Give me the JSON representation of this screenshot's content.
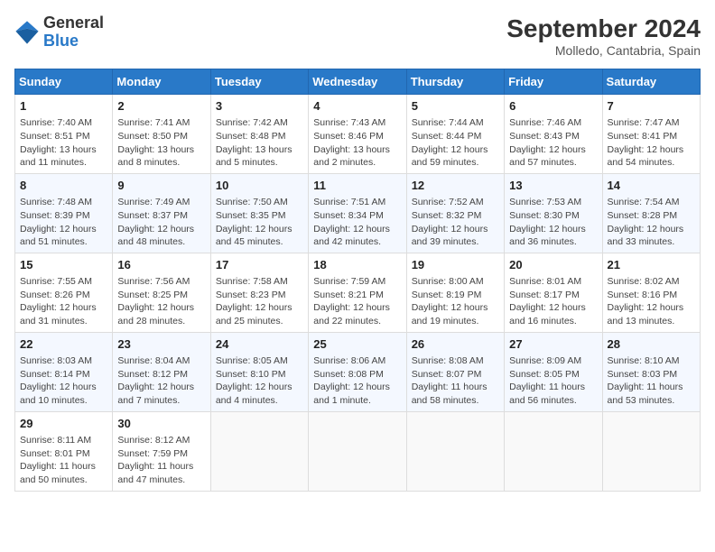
{
  "header": {
    "logo_general": "General",
    "logo_blue": "Blue",
    "month_year": "September 2024",
    "location": "Molledo, Cantabria, Spain"
  },
  "calendar": {
    "days_of_week": [
      "Sunday",
      "Monday",
      "Tuesday",
      "Wednesday",
      "Thursday",
      "Friday",
      "Saturday"
    ],
    "weeks": [
      [
        {
          "day": "1",
          "detail": "Sunrise: 7:40 AM\nSunset: 8:51 PM\nDaylight: 13 hours\nand 11 minutes."
        },
        {
          "day": "2",
          "detail": "Sunrise: 7:41 AM\nSunset: 8:50 PM\nDaylight: 13 hours\nand 8 minutes."
        },
        {
          "day": "3",
          "detail": "Sunrise: 7:42 AM\nSunset: 8:48 PM\nDaylight: 13 hours\nand 5 minutes."
        },
        {
          "day": "4",
          "detail": "Sunrise: 7:43 AM\nSunset: 8:46 PM\nDaylight: 13 hours\nand 2 minutes."
        },
        {
          "day": "5",
          "detail": "Sunrise: 7:44 AM\nSunset: 8:44 PM\nDaylight: 12 hours\nand 59 minutes."
        },
        {
          "day": "6",
          "detail": "Sunrise: 7:46 AM\nSunset: 8:43 PM\nDaylight: 12 hours\nand 57 minutes."
        },
        {
          "day": "7",
          "detail": "Sunrise: 7:47 AM\nSunset: 8:41 PM\nDaylight: 12 hours\nand 54 minutes."
        }
      ],
      [
        {
          "day": "8",
          "detail": "Sunrise: 7:48 AM\nSunset: 8:39 PM\nDaylight: 12 hours\nand 51 minutes."
        },
        {
          "day": "9",
          "detail": "Sunrise: 7:49 AM\nSunset: 8:37 PM\nDaylight: 12 hours\nand 48 minutes."
        },
        {
          "day": "10",
          "detail": "Sunrise: 7:50 AM\nSunset: 8:35 PM\nDaylight: 12 hours\nand 45 minutes."
        },
        {
          "day": "11",
          "detail": "Sunrise: 7:51 AM\nSunset: 8:34 PM\nDaylight: 12 hours\nand 42 minutes."
        },
        {
          "day": "12",
          "detail": "Sunrise: 7:52 AM\nSunset: 8:32 PM\nDaylight: 12 hours\nand 39 minutes."
        },
        {
          "day": "13",
          "detail": "Sunrise: 7:53 AM\nSunset: 8:30 PM\nDaylight: 12 hours\nand 36 minutes."
        },
        {
          "day": "14",
          "detail": "Sunrise: 7:54 AM\nSunset: 8:28 PM\nDaylight: 12 hours\nand 33 minutes."
        }
      ],
      [
        {
          "day": "15",
          "detail": "Sunrise: 7:55 AM\nSunset: 8:26 PM\nDaylight: 12 hours\nand 31 minutes."
        },
        {
          "day": "16",
          "detail": "Sunrise: 7:56 AM\nSunset: 8:25 PM\nDaylight: 12 hours\nand 28 minutes."
        },
        {
          "day": "17",
          "detail": "Sunrise: 7:58 AM\nSunset: 8:23 PM\nDaylight: 12 hours\nand 25 minutes."
        },
        {
          "day": "18",
          "detail": "Sunrise: 7:59 AM\nSunset: 8:21 PM\nDaylight: 12 hours\nand 22 minutes."
        },
        {
          "day": "19",
          "detail": "Sunrise: 8:00 AM\nSunset: 8:19 PM\nDaylight: 12 hours\nand 19 minutes."
        },
        {
          "day": "20",
          "detail": "Sunrise: 8:01 AM\nSunset: 8:17 PM\nDaylight: 12 hours\nand 16 minutes."
        },
        {
          "day": "21",
          "detail": "Sunrise: 8:02 AM\nSunset: 8:16 PM\nDaylight: 12 hours\nand 13 minutes."
        }
      ],
      [
        {
          "day": "22",
          "detail": "Sunrise: 8:03 AM\nSunset: 8:14 PM\nDaylight: 12 hours\nand 10 minutes."
        },
        {
          "day": "23",
          "detail": "Sunrise: 8:04 AM\nSunset: 8:12 PM\nDaylight: 12 hours\nand 7 minutes."
        },
        {
          "day": "24",
          "detail": "Sunrise: 8:05 AM\nSunset: 8:10 PM\nDaylight: 12 hours\nand 4 minutes."
        },
        {
          "day": "25",
          "detail": "Sunrise: 8:06 AM\nSunset: 8:08 PM\nDaylight: 12 hours\nand 1 minute."
        },
        {
          "day": "26",
          "detail": "Sunrise: 8:08 AM\nSunset: 8:07 PM\nDaylight: 11 hours\nand 58 minutes."
        },
        {
          "day": "27",
          "detail": "Sunrise: 8:09 AM\nSunset: 8:05 PM\nDaylight: 11 hours\nand 56 minutes."
        },
        {
          "day": "28",
          "detail": "Sunrise: 8:10 AM\nSunset: 8:03 PM\nDaylight: 11 hours\nand 53 minutes."
        }
      ],
      [
        {
          "day": "29",
          "detail": "Sunrise: 8:11 AM\nSunset: 8:01 PM\nDaylight: 11 hours\nand 50 minutes."
        },
        {
          "day": "30",
          "detail": "Sunrise: 8:12 AM\nSunset: 7:59 PM\nDaylight: 11 hours\nand 47 minutes."
        },
        {
          "day": "",
          "detail": ""
        },
        {
          "day": "",
          "detail": ""
        },
        {
          "day": "",
          "detail": ""
        },
        {
          "day": "",
          "detail": ""
        },
        {
          "day": "",
          "detail": ""
        }
      ]
    ]
  }
}
